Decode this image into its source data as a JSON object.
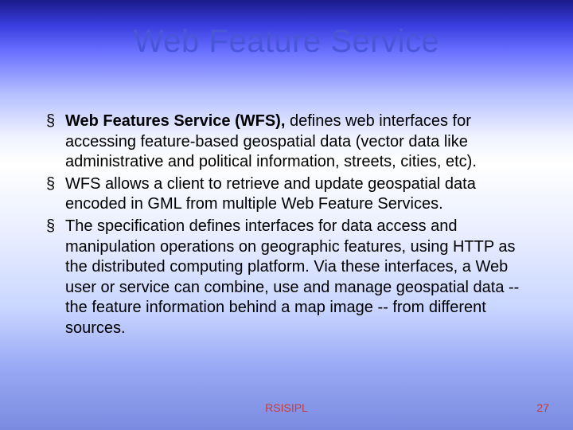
{
  "title": "Web Feature Service",
  "bullets": [
    {
      "lead": "Web Features Service (WFS),",
      "rest": " defines web interfaces for accessing feature-based geospatial data (vector data like administrative and political information, streets, cities, etc)."
    },
    {
      "lead": "",
      "rest": "WFS allows a client to retrieve and update geospatial data encoded in GML from multiple Web Feature Services."
    },
    {
      "lead": "",
      "rest": "The specification defines interfaces for data access and manipulation operations on geographic features, using HTTP as the distributed computing platform. Via these interfaces, a Web user or service can combine, use and manage geospatial data -- the feature information behind a map image -- from different sources."
    }
  ],
  "footer": {
    "center": "RSISIPL",
    "pageNumber": "27"
  }
}
